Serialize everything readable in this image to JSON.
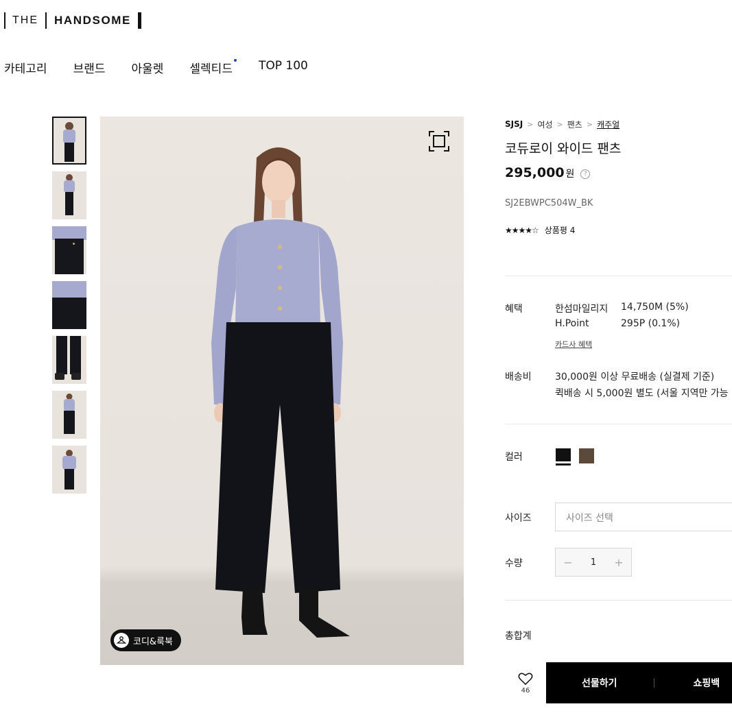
{
  "logo": {
    "the": "THE",
    "handsome": "HANDSOME"
  },
  "nav": [
    {
      "label": "카테고리"
    },
    {
      "label": "브랜드"
    },
    {
      "label": "아울렛"
    },
    {
      "label": "셀렉티드"
    },
    {
      "label": "TOP 100"
    }
  ],
  "gallery": {
    "thumbnails": [
      "full-body front",
      "full-body side",
      "pants detail waist",
      "pants detail pocket",
      "pants hem with boots",
      "full-body walking",
      "full-body front alt"
    ],
    "active_index": 0,
    "codi_label": "코디&룩북"
  },
  "product": {
    "breadcrumb": [
      "SJSJ",
      "여성",
      "팬츠",
      "캐주얼"
    ],
    "name": "코듀로이 와이드 팬츠",
    "price": "295,000",
    "currency": "원",
    "code": "SJ2EBWPC504W_BK",
    "rating_stars": 4.5,
    "review_label": "상품평 4"
  },
  "benefit": {
    "label": "혜택",
    "rows": [
      {
        "name": "한섬마일리지",
        "value": "14,750M (5%)"
      },
      {
        "name": "H.Point",
        "value": "295P (0.1%)"
      }
    ],
    "card_link": "카드사 혜택"
  },
  "shipping": {
    "label": "배송비",
    "line1": "30,000원 이상 무료배송 (실결제 기준)",
    "line2": "퀵배송 시 5,000원 별도 (서울 지역만 가능"
  },
  "color": {
    "label": "컬러",
    "options": [
      {
        "hex": "#111111",
        "selected": true
      },
      {
        "hex": "#5b4a3c",
        "selected": false
      }
    ]
  },
  "size": {
    "label": "사이즈",
    "placeholder": "사이즈 선택"
  },
  "quantity": {
    "label": "수량",
    "value": "1"
  },
  "total": {
    "label": "총합계"
  },
  "actions": {
    "like_count": "46",
    "gift": "선물하기",
    "cart": "쇼핑백"
  }
}
